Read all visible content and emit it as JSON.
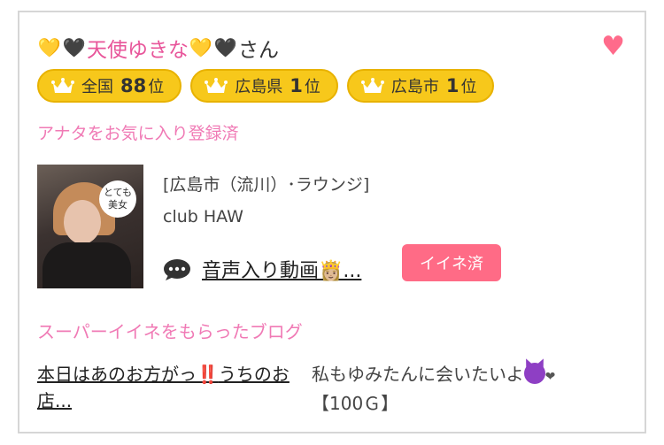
{
  "profile": {
    "name_prefix_emojis": [
      "💛",
      "🖤"
    ],
    "name": "天使ゆきな",
    "name_suffix_emojis": [
      "💛",
      "🖤"
    ],
    "honorific": "さん",
    "favorite_icon": "heart-icon"
  },
  "rankings": [
    {
      "label": "全国",
      "rank": "88",
      "suffix": "位",
      "icon": "crown-icon"
    },
    {
      "label": "広島県",
      "rank": "1",
      "suffix": "位",
      "icon": "crown-icon"
    },
    {
      "label": "広島市",
      "rank": "1",
      "suffix": "位",
      "icon": "crown-icon"
    }
  ],
  "favorite_status": "アナタをお気に入り登録済",
  "shop": {
    "area": "[広島市（流川）･ラウンジ]",
    "name": "club HAW",
    "thumbnail_caption": "とても美女"
  },
  "video": {
    "icon": "speech-bubble-icon",
    "label": "音声入り動画👸🏼..."
  },
  "iine_button": "イイネ済",
  "super_iine_section": {
    "title": "スーパーイイネをもらったブログ",
    "blog_title_part1": "本日はあのお方がっ",
    "blog_title_marks": "‼️",
    "blog_title_part2": "うちのお店...",
    "comment_text": "私もゆみたんに会いたいよ",
    "comment_heart": "❤",
    "comment_price": "【100Ｇ】"
  },
  "colors": {
    "pink_text": "#f07ab5",
    "badge_gold": "#f7c81b",
    "iine_pink": "#ff6b86",
    "heart_pink": "#ff6b8b"
  }
}
